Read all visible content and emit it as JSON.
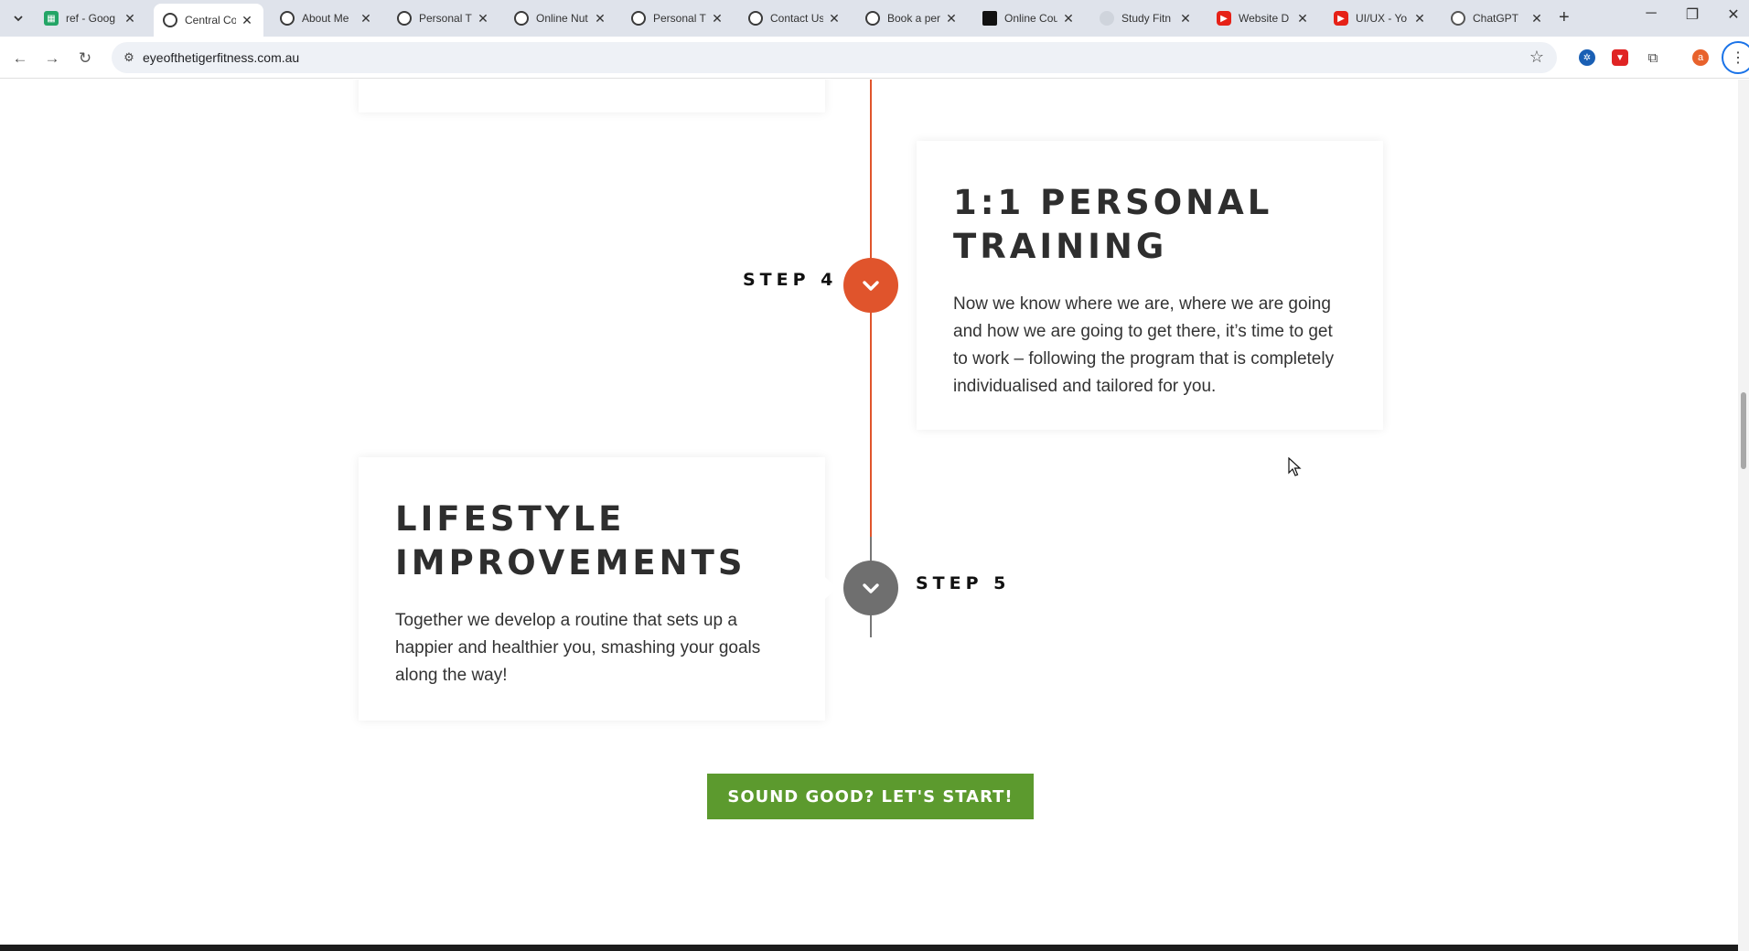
{
  "browser": {
    "tabs": [
      {
        "title": "ref - Goog",
        "favicon": "sheets-icon"
      },
      {
        "title": "Central Co",
        "favicon": "tiger-icon",
        "active": true
      },
      {
        "title": "About Me",
        "favicon": "tiger-icon"
      },
      {
        "title": "Personal T",
        "favicon": "tiger-icon"
      },
      {
        "title": "Online Nut",
        "favicon": "tiger-icon"
      },
      {
        "title": "Personal T",
        "favicon": "tiger-icon"
      },
      {
        "title": "Contact Us",
        "favicon": "tiger-icon"
      },
      {
        "title": "Book a per",
        "favicon": "tiger-icon"
      },
      {
        "title": "Online Cou",
        "favicon": "dark-icon"
      },
      {
        "title": "Study Fitn",
        "favicon": "study-icon"
      },
      {
        "title": "Website D",
        "favicon": "youtube-icon"
      },
      {
        "title": "UI/UX - Yo",
        "favicon": "youtube-icon"
      },
      {
        "title": "ChatGPT",
        "favicon": "chatgpt-icon"
      }
    ],
    "url": "eyeofthetigerfitness.com.au",
    "profile_initial": "a"
  },
  "steps": {
    "step4": {
      "label": "STEP 4",
      "title_line1": "1:1 PERSONAL",
      "title_line2": "TRAINING",
      "body": "Now we know where we are, where we are going and how we are going to get there, it’s time to get to work – following the program that is completely individualised and tailored for you."
    },
    "step5": {
      "label": "STEP 5",
      "title_line1": "LIFESTYLE",
      "title_line2": "IMPROVEMENTS",
      "body": "Together we develop a routine that sets up a happier and healthier you, smashing your goals along the way!"
    }
  },
  "cta": {
    "label": "SOUND GOOD? LET'S START!"
  },
  "colors": {
    "accent_orange": "#e0542c",
    "inactive_grey": "#777777",
    "cta_green": "#5c9a2e"
  }
}
